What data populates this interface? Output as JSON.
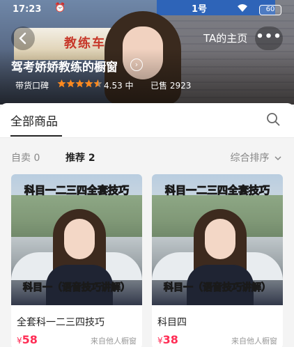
{
  "status": {
    "time": "17:23",
    "battery": "60"
  },
  "header": {
    "home_label": "TA的主页",
    "more_label": "•••"
  },
  "shop": {
    "title": "驾考娇娇教练的橱窗",
    "rating_label": "带货口碑",
    "rating_stars": 4.53,
    "rating_score": "4.53 中",
    "sold": "已售 2923",
    "banner_sign": "教练车",
    "pole_sign": "1号"
  },
  "tabs": {
    "all_products": "全部商品"
  },
  "filters": {
    "self_sell": "自卖 0",
    "recommended": "推荐 2",
    "sort": "综合排序"
  },
  "products": [
    {
      "caption_top": "科目一二三四全套技巧",
      "caption_bottom": "科目一（语音技巧讲解）",
      "name": "全套科一二三四技巧",
      "currency": "¥",
      "price": "58",
      "source": "来自他人橱窗"
    },
    {
      "caption_top": "科目一二三四全套技巧",
      "caption_bottom": "科目一（语音技巧讲解）",
      "name": "科目四",
      "currency": "¥",
      "price": "38",
      "source": "来自他人橱窗"
    }
  ],
  "colors": {
    "accent_price": "#ff2d55",
    "star": "#ff8a1f",
    "caption": "#ffe21a"
  },
  "icons": {
    "back": "chevron-left-icon",
    "title": "chevron-right-circle-icon",
    "search": "search-icon",
    "sort": "chevron-down-icon",
    "wifi": "wifi-icon",
    "alarm": "alarm-icon"
  }
}
